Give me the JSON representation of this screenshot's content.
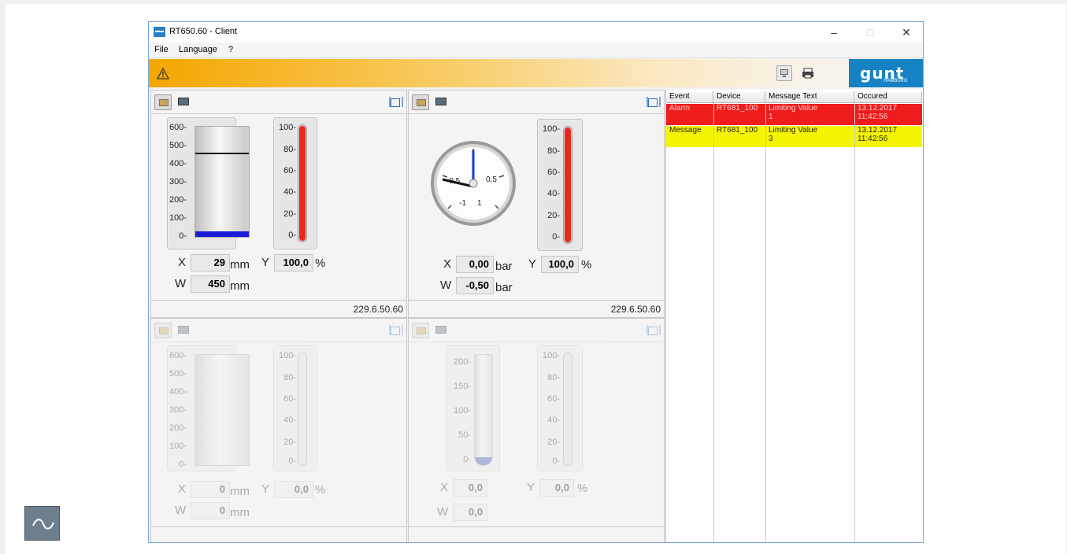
{
  "window": {
    "title": "RT650.60 - Client"
  },
  "menu": [
    "File",
    "Language",
    "?"
  ],
  "toolbar": {
    "logo_text": "gunt",
    "logo_subtext": "HAMBURG"
  },
  "panels": [
    {
      "scale_left": [
        "600-",
        "500-",
        "400-",
        "300-",
        "200-",
        "100-",
        "0-"
      ],
      "scale_right": [
        "100-",
        "80-",
        "60-",
        "40-",
        "20-",
        "0-"
      ],
      "x_label": "X",
      "x_value": "29",
      "x_unit": "mm",
      "y_label": "Y",
      "y_value": "100,0",
      "y_unit": "%",
      "w_label": "W",
      "w_value": "450",
      "w_unit": "mm",
      "ip": "229.6.50.60",
      "tank_level_fraction": 0.048,
      "setpoint_fraction": 0.75,
      "y_fill_percent": 100
    },
    {
      "dial_labels": [
        "-0,5",
        "0,5",
        "-1",
        "1"
      ],
      "scale_right": [
        "100-",
        "80-",
        "60-",
        "40-",
        "20-",
        "0-"
      ],
      "x_label": "X",
      "x_value": "0,00",
      "x_unit": "bar",
      "y_label": "Y",
      "y_value": "100,0",
      "y_unit": "%",
      "w_label": "W",
      "w_value": "-0,50",
      "w_unit": "bar",
      "ip": "229.6.50.60",
      "y_fill_percent": 100
    },
    {
      "scale_left": [
        "600-",
        "500-",
        "400-",
        "300-",
        "200-",
        "100-",
        "0-"
      ],
      "scale_right": [
        "100-",
        "80-",
        "60-",
        "40-",
        "20-",
        "0-"
      ],
      "x_label": "X",
      "x_value": "0",
      "x_unit": "mm",
      "y_label": "Y",
      "y_value": "0,0",
      "y_unit": "%",
      "w_label": "W",
      "w_value": "0",
      "w_unit": "mm"
    },
    {
      "scale_left": [
        "200-",
        "150-",
        "100-",
        "50-",
        "0-"
      ],
      "scale_right": [
        "100-",
        "80-",
        "60-",
        "40-",
        "20-",
        "0-"
      ],
      "x_label": "X",
      "x_value": "0,0",
      "x_unit": "",
      "y_label": "Y",
      "y_value": "0,0",
      "y_unit": "%",
      "w_label": "W",
      "w_value": "0,0",
      "w_unit": ""
    }
  ],
  "messages": {
    "headers": [
      "Event",
      "Device",
      "Message Text",
      "Occured"
    ],
    "rows": [
      {
        "event": "Alarm",
        "device": "RT681_100",
        "text1": "Limiting Value",
        "text2": "1",
        "date": "13.12.2017",
        "time": "11:42:56",
        "color": "#ee1c1c",
        "text_color": "#ffd0d0"
      },
      {
        "event": "Message",
        "device": "RT681_100",
        "text1": "Limiting Value",
        "text2": "3",
        "date": "13.12.2017",
        "time": "11:42:56",
        "color": "#f4f400",
        "text_color": "#222222"
      }
    ]
  },
  "colors": {
    "accent": "#1682c4",
    "toolbar": "#f4a600",
    "alarm": "#ee1c1c",
    "message": "#f4f400"
  },
  "icons": [
    "warning-icon",
    "monitor-icon",
    "printer-icon",
    "wave-icon",
    "maximize-icon"
  ]
}
